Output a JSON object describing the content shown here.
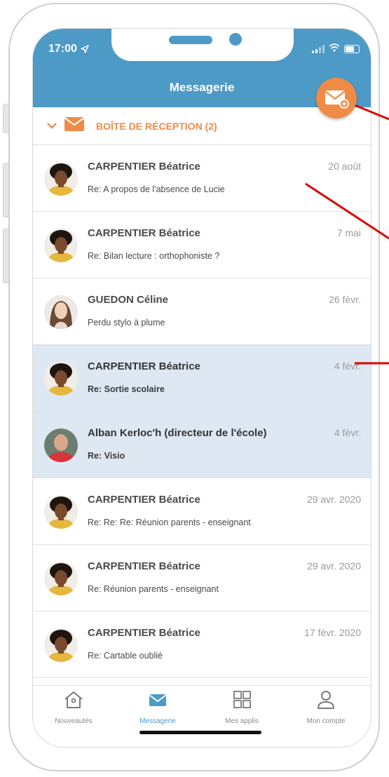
{
  "status": {
    "time": "17:00"
  },
  "header": {
    "title": "Messagerie"
  },
  "inbox": {
    "label": "BOÎTE DE RÉCEPTION (2)"
  },
  "messages": [
    {
      "sender": "CARPENTIER Béatrice",
      "subject": "Re: A propos de l'absence de Lucie",
      "date": "20 août",
      "unread": false,
      "avatar": "woman-afro"
    },
    {
      "sender": "CARPENTIER Béatrice",
      "subject": "Re: Bilan lecture : orthophoniste ?",
      "date": "7 mai",
      "unread": false,
      "avatar": "woman-afro"
    },
    {
      "sender": "GUEDON Céline",
      "subject": "Perdu stylo à plume",
      "date": "26 févr.",
      "unread": false,
      "avatar": "woman-long-hair"
    },
    {
      "sender": "CARPENTIER Béatrice",
      "subject": "Re: Sortie scolaire",
      "date": "4 févr.",
      "unread": true,
      "avatar": "woman-afro"
    },
    {
      "sender": "Alban Kerloc'h (directeur de l'école)",
      "subject": "Re: Visio",
      "date": "4 févr.",
      "unread": true,
      "avatar": "man-red-shirt"
    },
    {
      "sender": "CARPENTIER Béatrice",
      "subject": "Re: Re: Re: Réunion parents - enseignant",
      "date": "29 avr. 2020",
      "unread": false,
      "avatar": "woman-afro"
    },
    {
      "sender": "CARPENTIER Béatrice",
      "subject": "Re: Réunion parents - enseignant",
      "date": "29 avr. 2020",
      "unread": false,
      "avatar": "woman-afro"
    },
    {
      "sender": "CARPENTIER Béatrice",
      "subject": "Re: Cartable oublié",
      "date": "17 févr. 2020",
      "unread": false,
      "avatar": "woman-afro"
    }
  ],
  "tabs": [
    {
      "label": "Nouveautés",
      "icon": "home-icon",
      "active": false
    },
    {
      "label": "Messagerie",
      "icon": "mail-icon",
      "active": true
    },
    {
      "label": "Mes applis",
      "icon": "grid-icon",
      "active": false
    },
    {
      "label": "Mon compte",
      "icon": "user-icon",
      "active": false
    }
  ],
  "colors": {
    "header": "#4d9ac7",
    "accent": "#f08b46",
    "unread_bg": "#dde8f3",
    "annotation": "#e00000"
  }
}
